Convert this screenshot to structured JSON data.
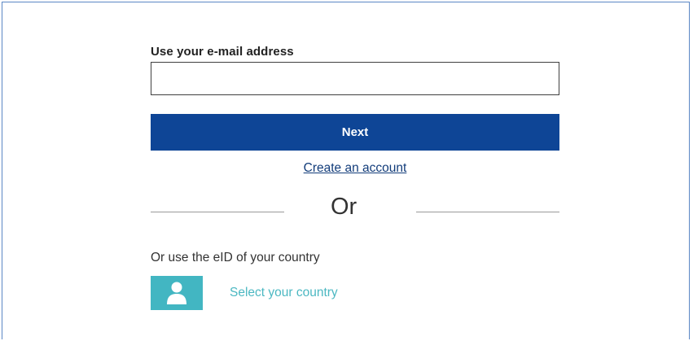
{
  "login": {
    "email_label": "Use your e-mail address",
    "email_value": "",
    "next_label": "Next",
    "create_account_label": "Create an account",
    "or_label": "Or",
    "eid_prompt": "Or use the eID of your country",
    "select_country_label": "Select your country",
    "country_icon": "user-icon"
  },
  "colors": {
    "primary_button": "#0e4596",
    "link": "#123c7a",
    "accent_teal": "#42b6c2",
    "frame_border": "#5b87c5"
  }
}
